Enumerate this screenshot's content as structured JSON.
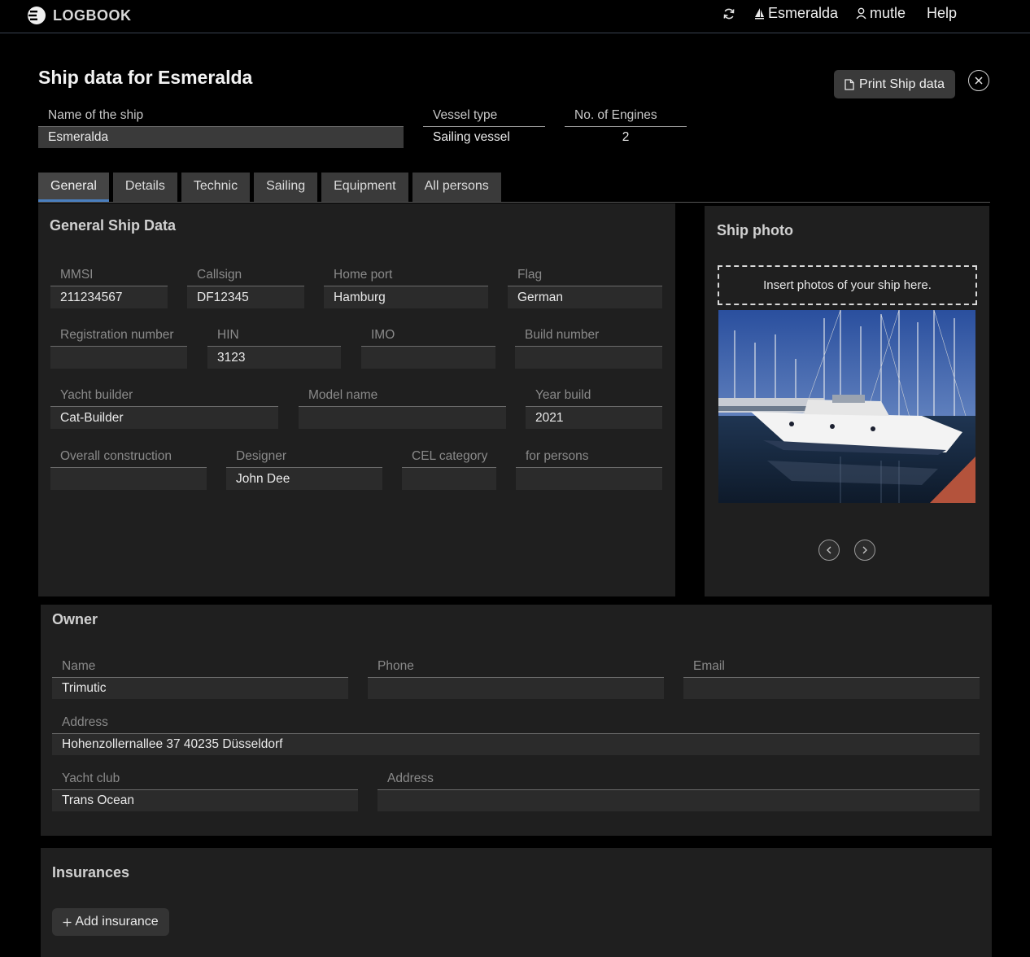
{
  "app": {
    "brand": "LOGBOOK"
  },
  "topnav": {
    "ship": "Esmeralda",
    "user": "mutle",
    "help": "Help"
  },
  "page": {
    "title": "Ship data for Esmeralda",
    "print_label": "Print Ship data"
  },
  "ship": {
    "name_label": "Name of the ship",
    "name_value": "Esmeralda",
    "type_label": "Vessel type",
    "type_value": "Sailing vessel",
    "engines_label": "No. of Engines",
    "engines_value": "2"
  },
  "tabs": [
    "General",
    "Details",
    "Technic",
    "Sailing",
    "Equipment",
    "All persons"
  ],
  "general": {
    "title": "General Ship Data",
    "fields": [
      {
        "label": "MMSI",
        "value": "211234567"
      },
      {
        "label": "Callsign",
        "value": "DF12345"
      },
      {
        "label": "Home port",
        "value": "Hamburg"
      },
      {
        "label": "Flag",
        "value": "German"
      },
      {
        "label": "Registration number",
        "value": ""
      },
      {
        "label": "HIN",
        "value": "3123"
      },
      {
        "label": "IMO",
        "value": ""
      },
      {
        "label": "Build number",
        "value": ""
      },
      {
        "label": "Yacht builder",
        "value": "Cat-Builder"
      },
      {
        "label": "Model name",
        "value": ""
      },
      {
        "label": "Year build",
        "value": "2021"
      },
      {
        "label": "Overall construction",
        "value": ""
      },
      {
        "label": "Designer",
        "value": "John Dee"
      },
      {
        "label": "CEL category",
        "value": ""
      },
      {
        "label": "for persons",
        "value": ""
      }
    ]
  },
  "photo": {
    "title": "Ship photo",
    "dropzone": "Insert photos of your ship here."
  },
  "owner": {
    "title": "Owner",
    "name_label": "Name",
    "name_value": "Trimutic",
    "phone_label": "Phone",
    "phone_value": "",
    "email_label": "Email",
    "email_value": "",
    "address_label": "Address",
    "address_value": "Hohenzollernallee 37 40235 Düsseldorf",
    "club_label": "Yacht club",
    "club_value": "Trans Ocean",
    "club_address_label": "Address",
    "club_address_value": ""
  },
  "insurances": {
    "title": "Insurances",
    "add_label": "Add insurance"
  },
  "colors": {
    "accent": "#4a7fbf",
    "panel": "#1f1f1f",
    "field": "#2b2b2b"
  }
}
